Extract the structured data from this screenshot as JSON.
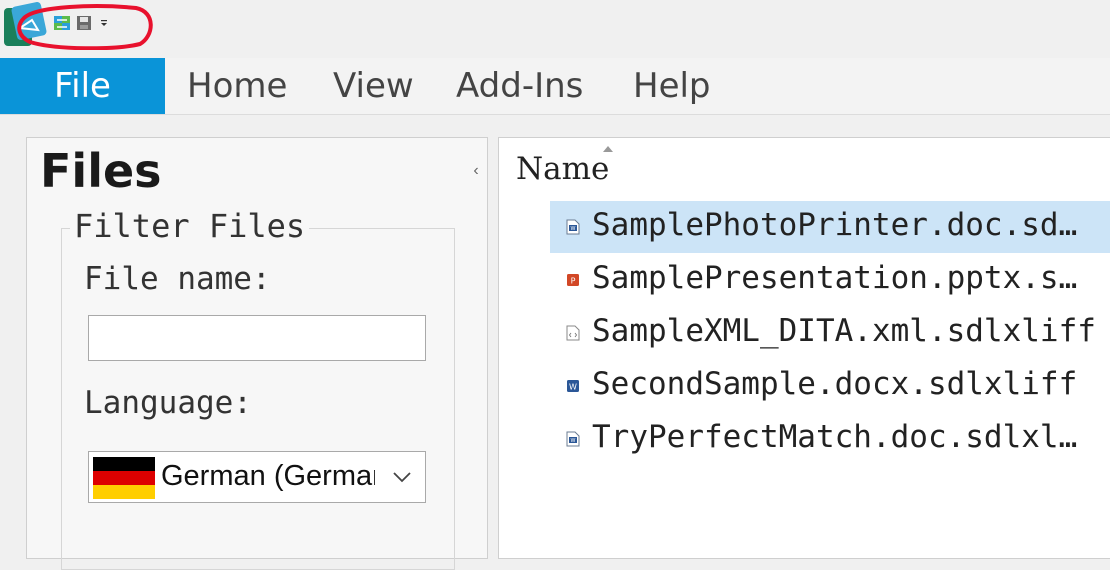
{
  "quick_access": {
    "logo_icon": "trados-app-logo-icon",
    "buttons": [
      {
        "name": "open-project-icon"
      },
      {
        "name": "save-icon"
      },
      {
        "name": "customize-dropdown-icon"
      }
    ],
    "annotation_color": "#e8112d"
  },
  "ribbon": {
    "tabs": [
      {
        "label": "File",
        "active": true
      },
      {
        "label": "Home"
      },
      {
        "label": "View"
      },
      {
        "label": "Add-Ins"
      },
      {
        "label": "Help"
      }
    ],
    "accent": "#0a94d8"
  },
  "files_panel": {
    "title": "Files",
    "collapse_glyph": "‹",
    "filter": {
      "legend": "Filter Files",
      "file_name_label": "File name:",
      "file_name_value": "",
      "language_label": "Language:",
      "language_value": "German (Germany)",
      "language_flag": "germany-flag-icon"
    }
  },
  "file_list": {
    "column_name": "Name",
    "rows": [
      {
        "name": "SamplePhotoPrinter.doc.sd…",
        "icon": "word-doc-icon",
        "selected": true
      },
      {
        "name": "SamplePresentation.pptx.s…",
        "icon": "powerpoint-icon"
      },
      {
        "name": "SampleXML_DITA.xml.sdlxliff",
        "icon": "xml-file-icon"
      },
      {
        "name": "SecondSample.docx.sdlxliff",
        "icon": "word-docx-icon"
      },
      {
        "name": "TryPerfectMatch.doc.sdlxl…",
        "icon": "word-doc-icon"
      }
    ]
  }
}
